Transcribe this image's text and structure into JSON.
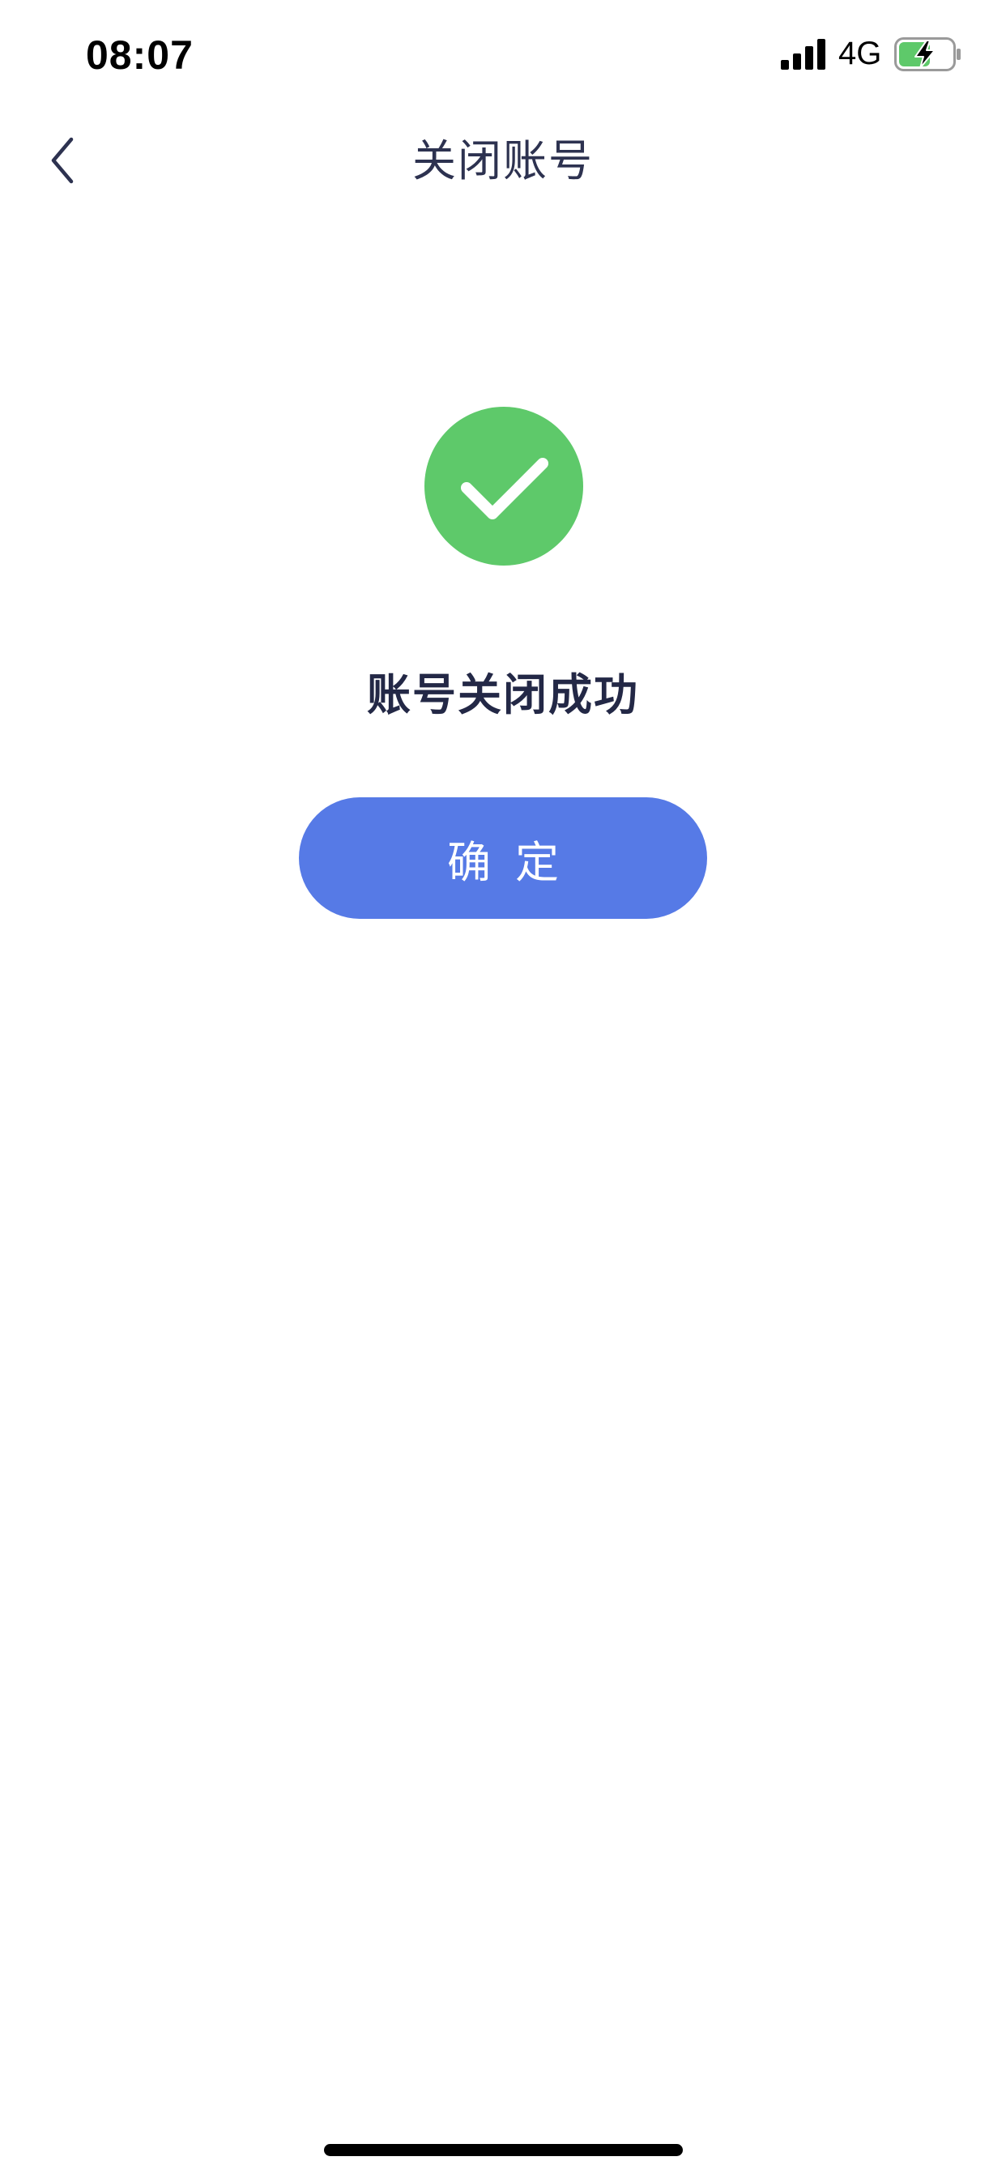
{
  "status_bar": {
    "time": "08:07",
    "network": "4G",
    "battery_color": "#5ec96a"
  },
  "nav": {
    "title": "关闭账号",
    "back_icon": "chevron-left-icon"
  },
  "result": {
    "icon": "check-circle-icon",
    "icon_color": "#5ec96a",
    "message": "账号关闭成功"
  },
  "actions": {
    "confirm_label": "确定",
    "confirm_color": "#567ae6"
  }
}
